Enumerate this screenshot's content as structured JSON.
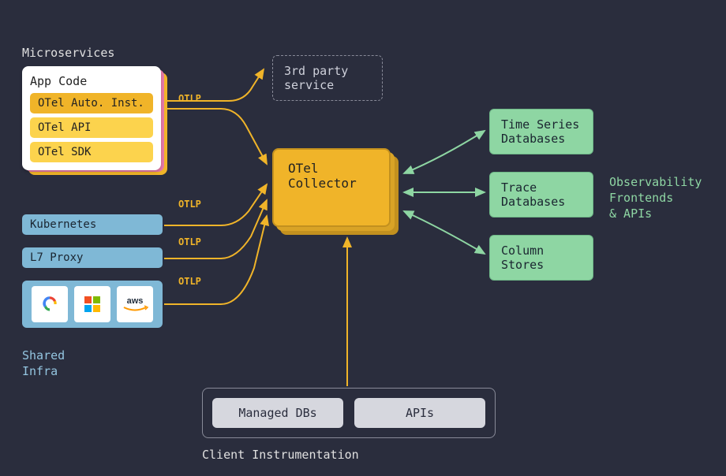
{
  "section_labels": {
    "microservices": "Microservices",
    "shared_infra_1": "Shared",
    "shared_infra_2": "Infra",
    "client_instrumentation": "Client Instrumentation",
    "observability_1": "Observability",
    "observability_2": "Frontends",
    "observability_3": "& APIs"
  },
  "appcode": {
    "title": "App Code",
    "items": [
      "OTel Auto. Inst.",
      "OTel API",
      "OTel SDK"
    ]
  },
  "shared_infra": {
    "kubernetes": "Kubernetes",
    "l7proxy": "L7 Proxy",
    "clouds": {
      "gcp": "gcp",
      "azure": "azure",
      "aws": "aws"
    }
  },
  "third_party": {
    "line1": "3rd party",
    "line2": "service"
  },
  "collector": {
    "line1": "OTel",
    "line2": "Collector"
  },
  "dbs": {
    "timeseries_1": "Time Series",
    "timeseries_2": "Databases",
    "trace_1": "Trace",
    "trace_2": "Databases",
    "column_1": "Column",
    "column_2": "Stores"
  },
  "client": {
    "managed_dbs": "Managed DBs",
    "apis": "APIs"
  },
  "edge_label": "OTLP"
}
